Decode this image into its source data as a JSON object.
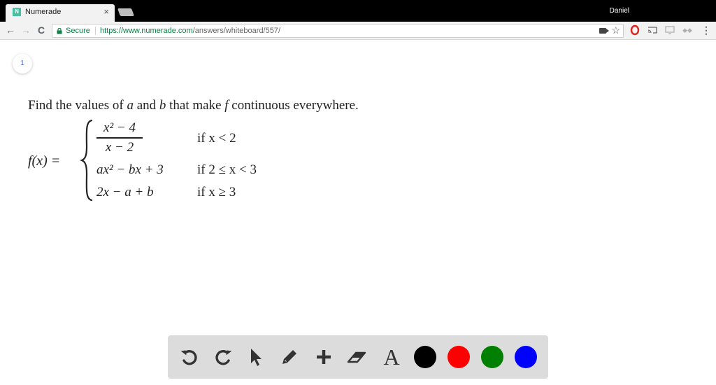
{
  "browser": {
    "tab_title": "Numerade",
    "tab_favicon": "N",
    "tab_close": "×",
    "user_name": "Daniel",
    "nav": {
      "back": "←",
      "forward": "→",
      "reload": "C"
    },
    "secure_label": "Secure",
    "url_base": "https://www.numerade.com",
    "url_path": "/answers/whiteboard/557/"
  },
  "page": {
    "page_number": "1",
    "problem": {
      "part1": "Find the values of ",
      "var_a": "a",
      "part2": " and ",
      "var_b": "b",
      "part3": " that make ",
      "var_f": "f",
      "part4": " continuous everywhere."
    },
    "function_lhs": "f(x) =",
    "cases": [
      {
        "numerator": "x² − 4",
        "denominator": "x − 2",
        "condition": "if x < 2"
      },
      {
        "expression": "ax² − bx + 3",
        "condition": "if 2 ≤ x < 3"
      },
      {
        "expression": "2x − a + b",
        "condition": "if x ≥ 3"
      }
    ]
  },
  "whiteboard_toolbar": {
    "tools": [
      "undo-icon",
      "redo-icon",
      "pointer-icon",
      "pencil-icon",
      "plus-icon",
      "eraser-icon",
      "text-tool-icon"
    ],
    "text_tool_glyph": "A",
    "colors": [
      "#000000",
      "#ff0000",
      "#008000",
      "#0000ff"
    ]
  }
}
